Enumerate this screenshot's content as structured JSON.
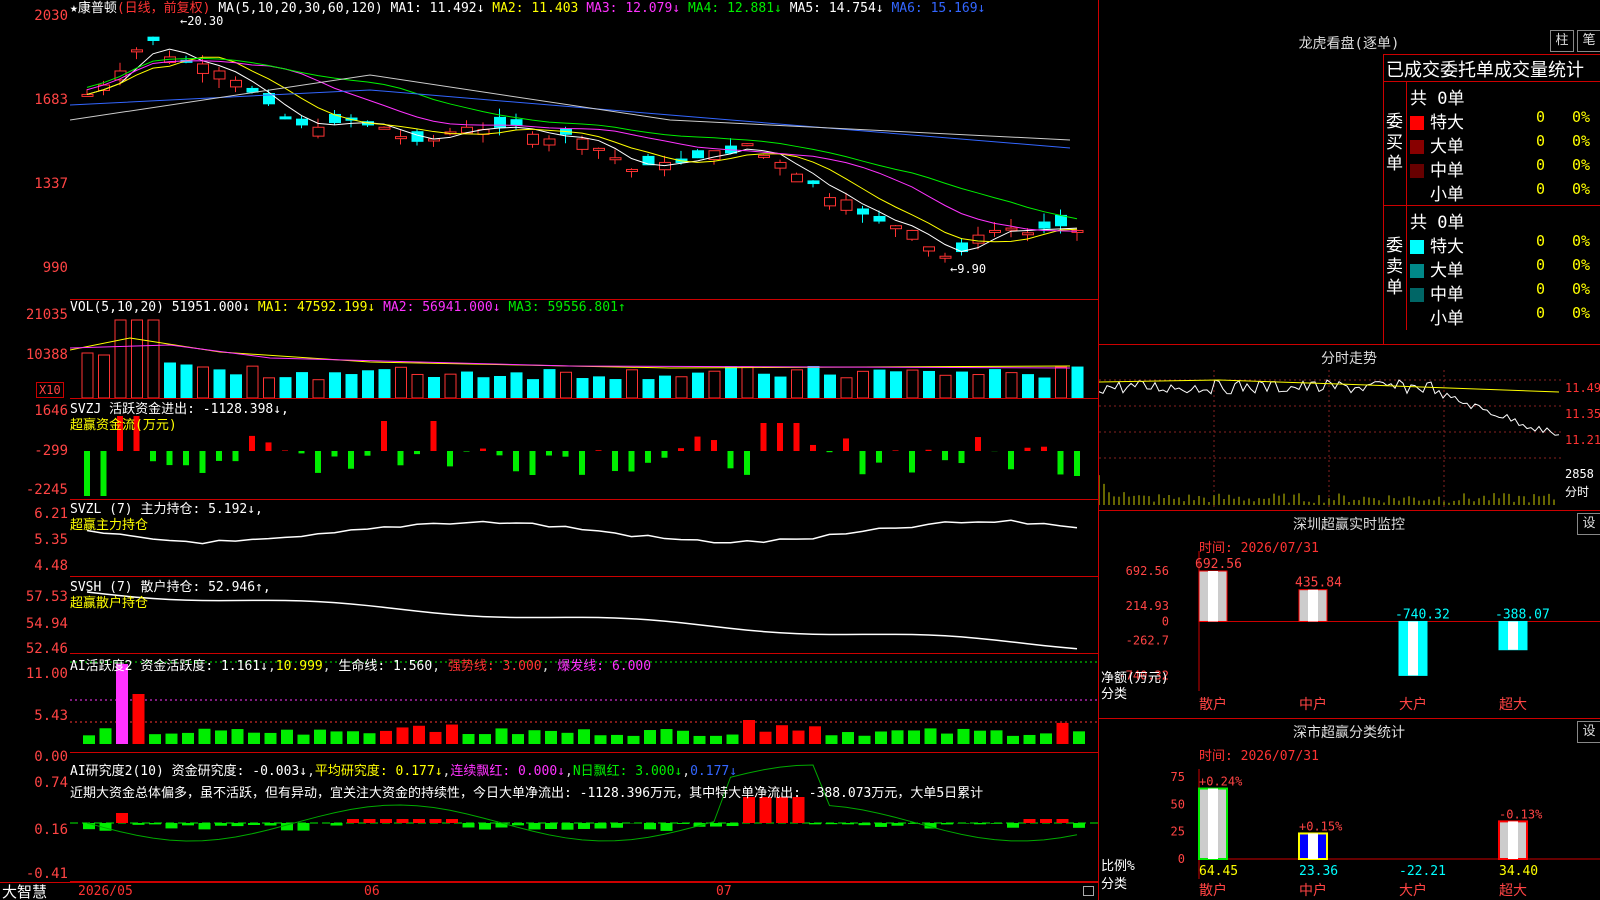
{
  "stock": {
    "name_line": "★康普顿",
    "period": "(日线，前复权)",
    "ma_label": "MA(5,10,20,30,60,120)",
    "ma": [
      {
        "label": "MA1: 11.492↓",
        "color": "#ffffff"
      },
      {
        "label": "MA2: 11.403",
        "color": "#ffff00"
      },
      {
        "label": "MA3: 12.079↓",
        "color": "#ff33ff"
      },
      {
        "label": "MA4: 12.881↓",
        "color": "#00ee00"
      },
      {
        "label": "MA5: 14.754↓",
        "color": "#cccccc"
      },
      {
        "label": "MA6: 15.169↓",
        "color": "#3366ff"
      }
    ],
    "high_mark": "20.30",
    "low_mark": "9.90",
    "price_axis": [
      "2030",
      "1683",
      "1337",
      "990"
    ]
  },
  "vol": {
    "label": "VOL(5,10,20)",
    "val": "51951.000↓",
    "ma1": "MA1: 47592.199↓",
    "ma2": "MA2: 56941.000↓",
    "ma3": "MA3: 59556.801↑",
    "axis": [
      "21035",
      "10388"
    ],
    "unit": "X10"
  },
  "svzj": {
    "label": "SVZJ  活跃资金进出: -1128.398↓,",
    "sub": "超赢资金流(万元)",
    "axis": [
      "1646",
      "-299",
      "-2245"
    ]
  },
  "svzl": {
    "label": "SVZL (7) 主力持仓: 5.192↓,",
    "sub": "超赢主力持仓",
    "axis": [
      "6.21",
      "5.35",
      "4.48"
    ]
  },
  "svsh": {
    "label": "SVSH (7) 散户持仓: 52.946↑,",
    "sub": "超赢散户持仓",
    "axis": [
      "57.53",
      "54.94",
      "52.46"
    ]
  },
  "ai1": {
    "label": "AI活跃度2",
    "p1": "资金活跃度: 1.161↓",
    "p2": "10.999",
    "p3": "生命线: 1.560",
    "p4": "强势线: 3.000",
    "p5": "爆发线: 6.000",
    "axis": [
      "11.00",
      "5.43",
      "0.00"
    ]
  },
  "ai2": {
    "label": "AI研究度2(10)",
    "p1": "资金研究度: -0.003↓",
    "p2": "平均研究度: 0.177↓",
    "p3": "连续飘红: 0.000↓",
    "p4": "N日飘红: 3.000↓",
    "p5": "0.177↓",
    "comment": "近期大资金总体偏多，虽不活跃，但有异动，宜关注大资金的持续性，今日大单净流出: -1128.396万元，其中特大单净流出: -388.073万元，大单5日累计",
    "axis": [
      "0.74",
      "0.16",
      "-0.41"
    ]
  },
  "xaxis": {
    "brand": "大智慧",
    "labels": [
      "2026/05",
      "06",
      "07"
    ]
  },
  "right": {
    "lhb_title": "龙虎看盘(逐单)",
    "btn_zhu": "柱",
    "btn_bi": "笔",
    "lhb_header": "已成交委托单成交量统计",
    "buy_side": "委买单",
    "sell_side": "委卖单",
    "buy_total": "共 0单",
    "sell_total": "共 0单",
    "buy_rows": [
      {
        "label": "特大",
        "val": "0",
        "pct": "0%",
        "color": "#ff0000"
      },
      {
        "label": "大单",
        "val": "0",
        "pct": "0%",
        "color": "#880000"
      },
      {
        "label": "中单",
        "val": "0",
        "pct": "0%",
        "color": "#660000"
      },
      {
        "label": "小单",
        "val": "0",
        "pct": "0%",
        "color": "#000000"
      }
    ],
    "sell_rows": [
      {
        "label": "特大",
        "val": "0",
        "pct": "0%",
        "color": "#00ffff"
      },
      {
        "label": "大单",
        "val": "0",
        "pct": "0%",
        "color": "#008888"
      },
      {
        "label": "中单",
        "val": "0",
        "pct": "0%",
        "color": "#006666"
      },
      {
        "label": "小单",
        "val": "0",
        "pct": "0%",
        "color": "#000000"
      }
    ],
    "fenshi_title": "分时走势",
    "fenshi_axis": [
      "11.49",
      "11.35",
      "11.21"
    ],
    "fenshi_vol": "2858",
    "fenshi_unit": "分时",
    "sz_title": "深圳超赢实时监控",
    "sz_btn": "设",
    "sz_time": "时间: 2026/07/31",
    "sz_axis": [
      "692.56",
      "214.93",
      "0",
      "-262.7",
      "-740.32"
    ],
    "sz_ylabel": "净额(万元)",
    "sz_xlabel": "分类",
    "sz_cats": [
      "散户",
      "中户",
      "大户",
      "超大"
    ],
    "sz_values": [
      692.56,
      435.84,
      -740.32,
      -388.07
    ],
    "sz_labels": [
      "692.56",
      "435.84",
      "-740.32",
      "-388.07"
    ],
    "cls_title": "深市超赢分类统计",
    "cls_btn": "设",
    "cls_time": "时间: 2026/07/31",
    "cls_axis": [
      "75",
      "50",
      "25",
      "0"
    ],
    "cls_ylabel": "比例%",
    "cls_xlabel": "分类",
    "cls_cats": [
      "散户",
      "中户",
      "大户",
      "超大"
    ],
    "cls_pct": [
      "+0.24%",
      "+0.15%",
      "",
      "-0.13%"
    ],
    "cls_values": [
      64.45,
      23.36,
      -22.21,
      34.4
    ],
    "cls_labels": [
      "64.45",
      "23.36",
      "-22.21",
      "34.40"
    ]
  }
}
